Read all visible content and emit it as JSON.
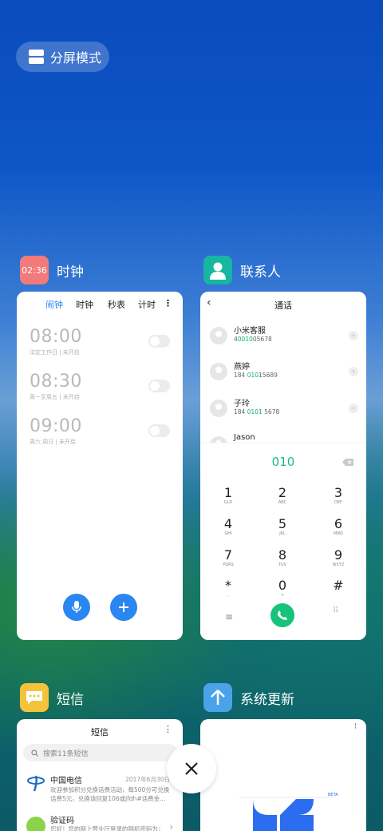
{
  "split_screen": {
    "label": "分屏模式"
  },
  "apps": {
    "clock": {
      "name": "时钟",
      "icon_text": "02:36",
      "icon_color": "#f27a7a",
      "tabs": [
        "闹钟",
        "时钟",
        "秒表",
        "计时"
      ],
      "active_tab_color": "#2a86f0",
      "alarms": [
        {
          "time": "08:00",
          "desc": "法定工作日 | 未开启"
        },
        {
          "time": "08:30",
          "desc": "周一至周五 | 未开启"
        },
        {
          "time": "09:00",
          "desc": "周六 周日 | 未开启"
        }
      ]
    },
    "contacts": {
      "name": "联系人",
      "icon_color": "#17b6a0",
      "title": "通话",
      "entries": [
        {
          "name": "小米客服",
          "num_pre": "4",
          "num_hi": "0010",
          "num_post": "05678"
        },
        {
          "name": "燕婷",
          "num_pre": "184 ",
          "num_hi": "010",
          "num_post": "15689"
        },
        {
          "name": "子玲",
          "num_pre": "184 ",
          "num_hi": "0101",
          "num_post": " 5678"
        },
        {
          "name": "Jason",
          "num_pre": "",
          "num_hi": "",
          "num_post": ""
        }
      ],
      "dial_input": "010",
      "keys": [
        {
          "d": "1",
          "l": "GLD"
        },
        {
          "d": "2",
          "l": "ABC"
        },
        {
          "d": "3",
          "l": "DEF"
        },
        {
          "d": "4",
          "l": "GHI"
        },
        {
          "d": "5",
          "l": "JKL"
        },
        {
          "d": "6",
          "l": "MNO"
        },
        {
          "d": "7",
          "l": "PQRS"
        },
        {
          "d": "8",
          "l": "TUV"
        },
        {
          "d": "9",
          "l": "WXYZ"
        },
        {
          "d": "*",
          "l": ","
        },
        {
          "d": "0",
          "l": "+"
        },
        {
          "d": "#",
          "l": ""
        }
      ],
      "call_color": "#17c27a"
    },
    "sms": {
      "name": "短信",
      "icon_color": "#f5c33b",
      "title": "短信",
      "search_placeholder": "搜索11条短信",
      "messages": [
        {
          "sender": "中国电信",
          "date": "2017年6月30日",
          "line1": "欢迎参加积分兑换话费活动，每500分可兑换",
          "line2": "话费5元，兑换请回复106或jfdh#话费金..."
        },
        {
          "sender": "验证码",
          "date": "",
          "line1": "您好！您的网上营业厅登录的随机密码为：",
          "line2": ""
        }
      ]
    },
    "update": {
      "name": "系统更新",
      "icon_color": "#4aa3e8",
      "badge": "BETA"
    }
  }
}
